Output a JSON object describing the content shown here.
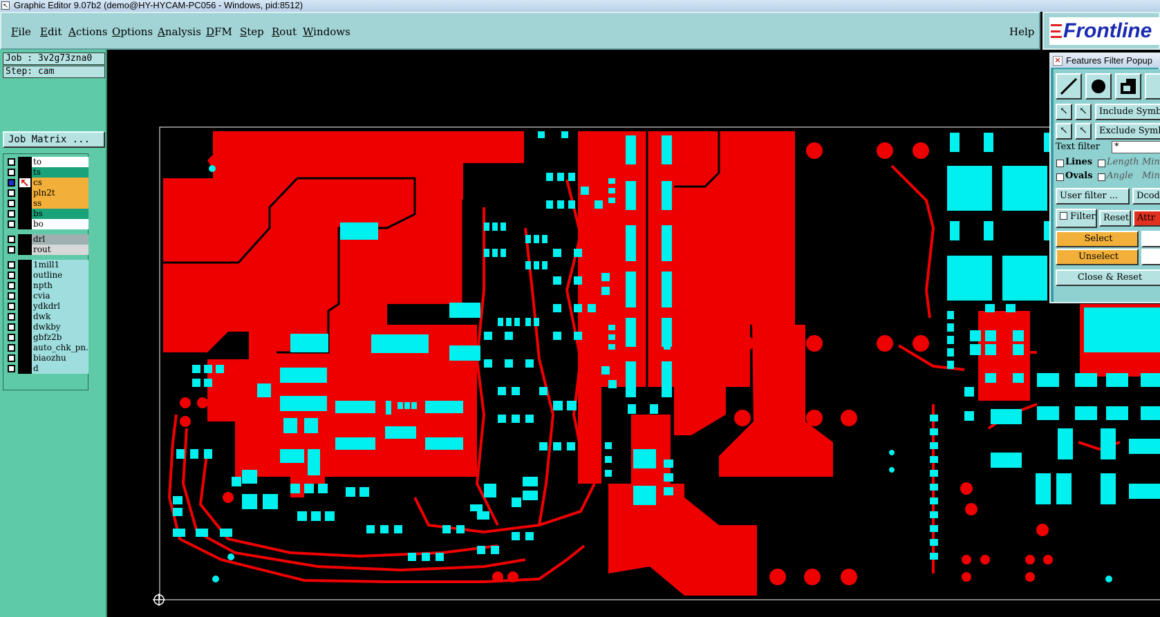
{
  "window": {
    "title": "Graphic Editor 9.07b2 (demo@HY-HYCAM-PC056 - Windows, pid:8512)"
  },
  "menubar": {
    "items": [
      {
        "first": "F",
        "rest": "ile"
      },
      {
        "first": "E",
        "rest": "dit"
      },
      {
        "first": "A",
        "rest": "ctions"
      },
      {
        "first": "O",
        "rest": "ptions"
      },
      {
        "first": "A",
        "rest": "nalysis"
      },
      {
        "first": "D",
        "rest": "FM"
      },
      {
        "first": "S",
        "rest": "tep"
      },
      {
        "first": "R",
        "rest": "out"
      },
      {
        "first": "W",
        "rest": "indows"
      }
    ],
    "help": "Help"
  },
  "logo": {
    "text": "Frontline"
  },
  "job": {
    "job_label": "Job : 3v2g73zna0",
    "step_label": "Step: cam",
    "matrix_button": "Job Matrix ..."
  },
  "layers": [
    {
      "name": "to",
      "color": "#ffffff",
      "checked": false
    },
    {
      "name": "ts",
      "color": "#1aa27a",
      "checked": false
    },
    {
      "name": "cs",
      "color": "#f2b03a",
      "checked": true
    },
    {
      "name": "pln2t",
      "color": "#f2b03a",
      "checked": false
    },
    {
      "name": "ss",
      "color": "#f2b03a",
      "checked": false
    },
    {
      "name": "bs",
      "color": "#1aa27a",
      "checked": false
    },
    {
      "name": "bo",
      "color": "#ffffff",
      "checked": false
    },
    {
      "name": "drl",
      "color": "#9fb0b0",
      "checked": false
    },
    {
      "name": "rout",
      "color": "#d8d8d8",
      "checked": false
    },
    {
      "name": "1mill1",
      "color": "#9edede",
      "checked": false
    },
    {
      "name": "outline",
      "color": "#9edede",
      "checked": false
    },
    {
      "name": "npth",
      "color": "#9edede",
      "checked": false
    },
    {
      "name": "cvia",
      "color": "#9edede",
      "checked": false
    },
    {
      "name": "ydkdrl",
      "color": "#9edede",
      "checked": false
    },
    {
      "name": "dwk",
      "color": "#9edede",
      "checked": false
    },
    {
      "name": "dwkby",
      "color": "#9edede",
      "checked": false
    },
    {
      "name": "gbfz2b",
      "color": "#9edede",
      "checked": false
    },
    {
      "name": "auto_chk_pn.",
      "color": "#9edede",
      "checked": false
    },
    {
      "name": "biaozhu",
      "color": "#9edede",
      "checked": false
    },
    {
      "name": "d",
      "color": "#9edede",
      "checked": false
    }
  ],
  "popup": {
    "title": "Features Filter Popup",
    "include_symbols": "Include Symbols",
    "exclude_symbols": "Exclude Symbols",
    "text_filter_label": "Text filter",
    "text_filter_value": "*",
    "lines_label": "Lines",
    "ovals_label": "Ovals",
    "length_label": "Length",
    "angle_label": "Angle",
    "min_label": "Min:",
    "user_filter": "User filter ...",
    "dcode": "Dcode",
    "filter_label": "Filter",
    "reset": "Reset",
    "attr": "Attr",
    "select": "Select",
    "unselect": "Unselect",
    "close_reset": "Close & Reset"
  },
  "colors": {
    "copper": "#ef0000",
    "pad": "#00f0f0",
    "background": "#000000",
    "panel": "#5fcaa8",
    "menubar": "#a2d4d6"
  }
}
